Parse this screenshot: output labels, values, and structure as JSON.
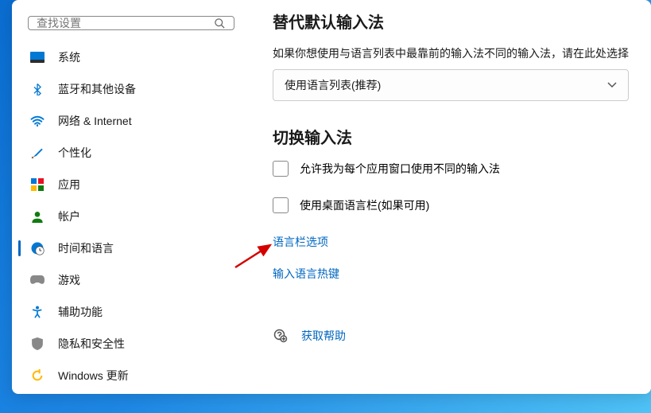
{
  "search": {
    "placeholder": "查找设置"
  },
  "sidebar": {
    "items": [
      {
        "label": "系统"
      },
      {
        "label": "蓝牙和其他设备"
      },
      {
        "label": "网络 & Internet"
      },
      {
        "label": "个性化"
      },
      {
        "label": "应用"
      },
      {
        "label": "帐户"
      },
      {
        "label": "时间和语言"
      },
      {
        "label": "游戏"
      },
      {
        "label": "辅助功能"
      },
      {
        "label": "隐私和安全性"
      },
      {
        "label": "Windows 更新"
      }
    ]
  },
  "sections": {
    "override": {
      "title": "替代默认输入法",
      "desc": "如果你想使用与语言列表中最靠前的输入法不同的输入法，请在此处选择",
      "selected": "使用语言列表(推荐)"
    },
    "switch": {
      "title": "切换输入法",
      "check1": "允许我为每个应用窗口使用不同的输入法",
      "check2": "使用桌面语言栏(如果可用)",
      "link1": "语言栏选项",
      "link2": "输入语言热键"
    }
  },
  "help": {
    "label": "获取帮助"
  }
}
